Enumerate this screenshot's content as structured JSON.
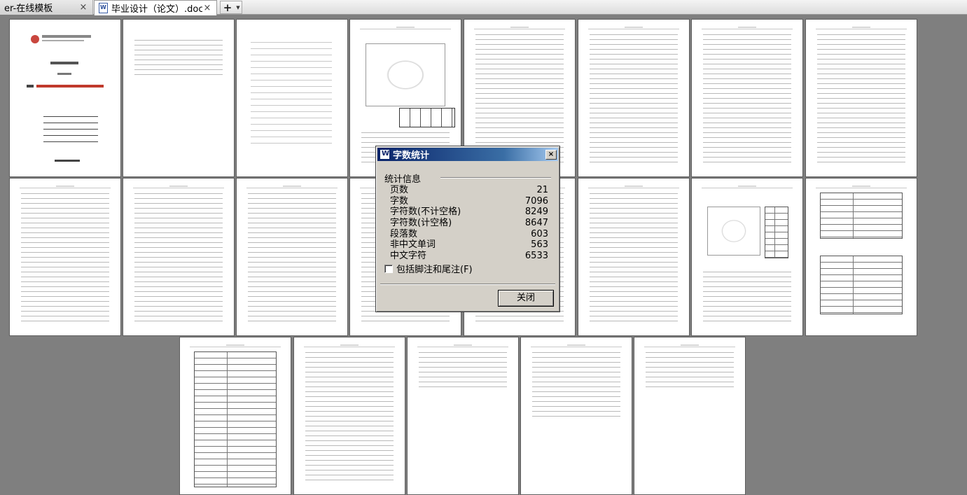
{
  "tabs": [
    {
      "label": "er-在线模板",
      "active": false
    },
    {
      "label": "毕业设计（论文）.doc",
      "active": true
    }
  ],
  "tabbar": {
    "close_glyph": "×",
    "new_tab_glyph": "+",
    "dropdown_glyph": "▼"
  },
  "dialog": {
    "title": "字数统计",
    "close_glyph": "×",
    "section_label": "统计信息",
    "stats": [
      {
        "label": "页数",
        "value": "21"
      },
      {
        "label": "字数",
        "value": "7096"
      },
      {
        "label": "字符数(不计空格)",
        "value": "8249"
      },
      {
        "label": "字符数(计空格)",
        "value": "8647"
      },
      {
        "label": "段落数",
        "value": "603"
      },
      {
        "label": "非中文单词",
        "value": "563"
      },
      {
        "label": "中文字符",
        "value": "6533"
      }
    ],
    "checkbox_label": "包括脚注和尾注(F)",
    "checkbox_checked": false,
    "close_button_label": "关闭"
  },
  "colors": {
    "background": "#7f7f7f",
    "dialog_face": "#d4d0c8",
    "dialog_title_start": "#0a246a",
    "dialog_title_end": "#a6caf0"
  }
}
